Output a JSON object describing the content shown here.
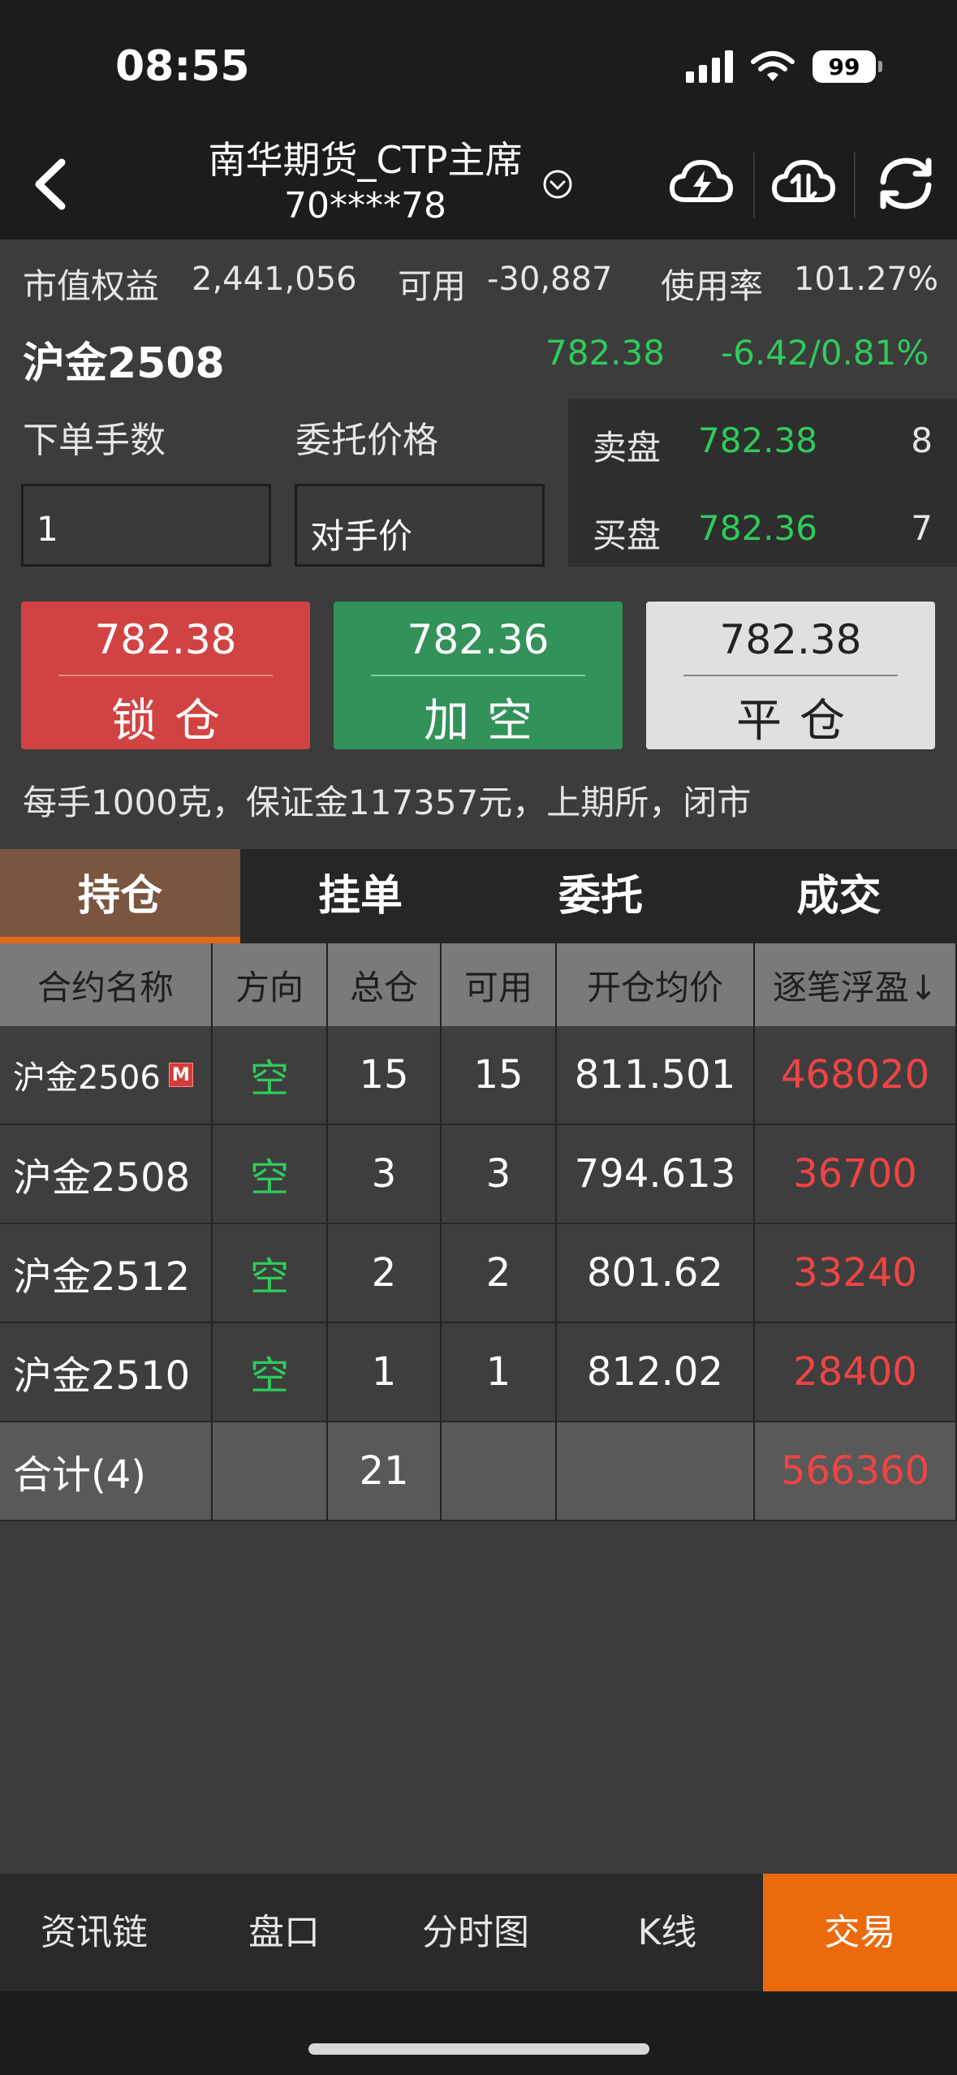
{
  "status_bar": {
    "time": "08:55",
    "battery": "99"
  },
  "header": {
    "title": "南华期货_CTP主席",
    "account": "70****78"
  },
  "account": {
    "equity_label": "市值权益",
    "equity_value": "2,441,056",
    "available_label": "可用",
    "available_value": "-30,887",
    "usage_label": "使用率",
    "usage_value": "101.27%"
  },
  "instrument": {
    "name": "沪金2508",
    "price": "782.38",
    "change": "-6.42/0.81%"
  },
  "order_form": {
    "qty_label": "下单手数",
    "price_label": "委托价格",
    "qty_value": "1",
    "price_value": "对手价"
  },
  "order_book": {
    "ask": {
      "label": "卖盘",
      "price": "782.38",
      "qty": "8"
    },
    "bid": {
      "label": "买盘",
      "price": "782.36",
      "qty": "7"
    }
  },
  "actions": [
    {
      "price": "782.38",
      "label": "锁仓"
    },
    {
      "price": "782.36",
      "label": "加空"
    },
    {
      "price": "782.38",
      "label": "平仓"
    }
  ],
  "note": "每手1000克，保证金117357元，上期所，闭市",
  "tabs": [
    "持仓",
    "挂单",
    "委托",
    "成交"
  ],
  "positions": {
    "headers": [
      "合约名称",
      "方向",
      "总仓",
      "可用",
      "开仓均价",
      "逐笔浮盈↓"
    ],
    "rows": [
      {
        "name": "沪金2506",
        "badge": "M",
        "direction": "空",
        "total": "15",
        "available": "15",
        "avg_price": "811.501",
        "pnl": "468020"
      },
      {
        "name": "沪金2508",
        "badge": "",
        "direction": "空",
        "total": "3",
        "available": "3",
        "avg_price": "794.613",
        "pnl": "36700"
      },
      {
        "name": "沪金2512",
        "badge": "",
        "direction": "空",
        "total": "2",
        "available": "2",
        "avg_price": "801.62",
        "pnl": "33240"
      },
      {
        "name": "沪金2510",
        "badge": "",
        "direction": "空",
        "total": "1",
        "available": "1",
        "avg_price": "812.02",
        "pnl": "28400"
      }
    ],
    "total": {
      "label": "合计(4)",
      "total": "21",
      "pnl": "566360"
    }
  },
  "bottom_nav": [
    "资讯链",
    "盘口",
    "分时图",
    "K线",
    "交易"
  ],
  "colors": {
    "up": "#ef4444",
    "down": "#2ecc5a",
    "accent": "#eb6a0c"
  }
}
